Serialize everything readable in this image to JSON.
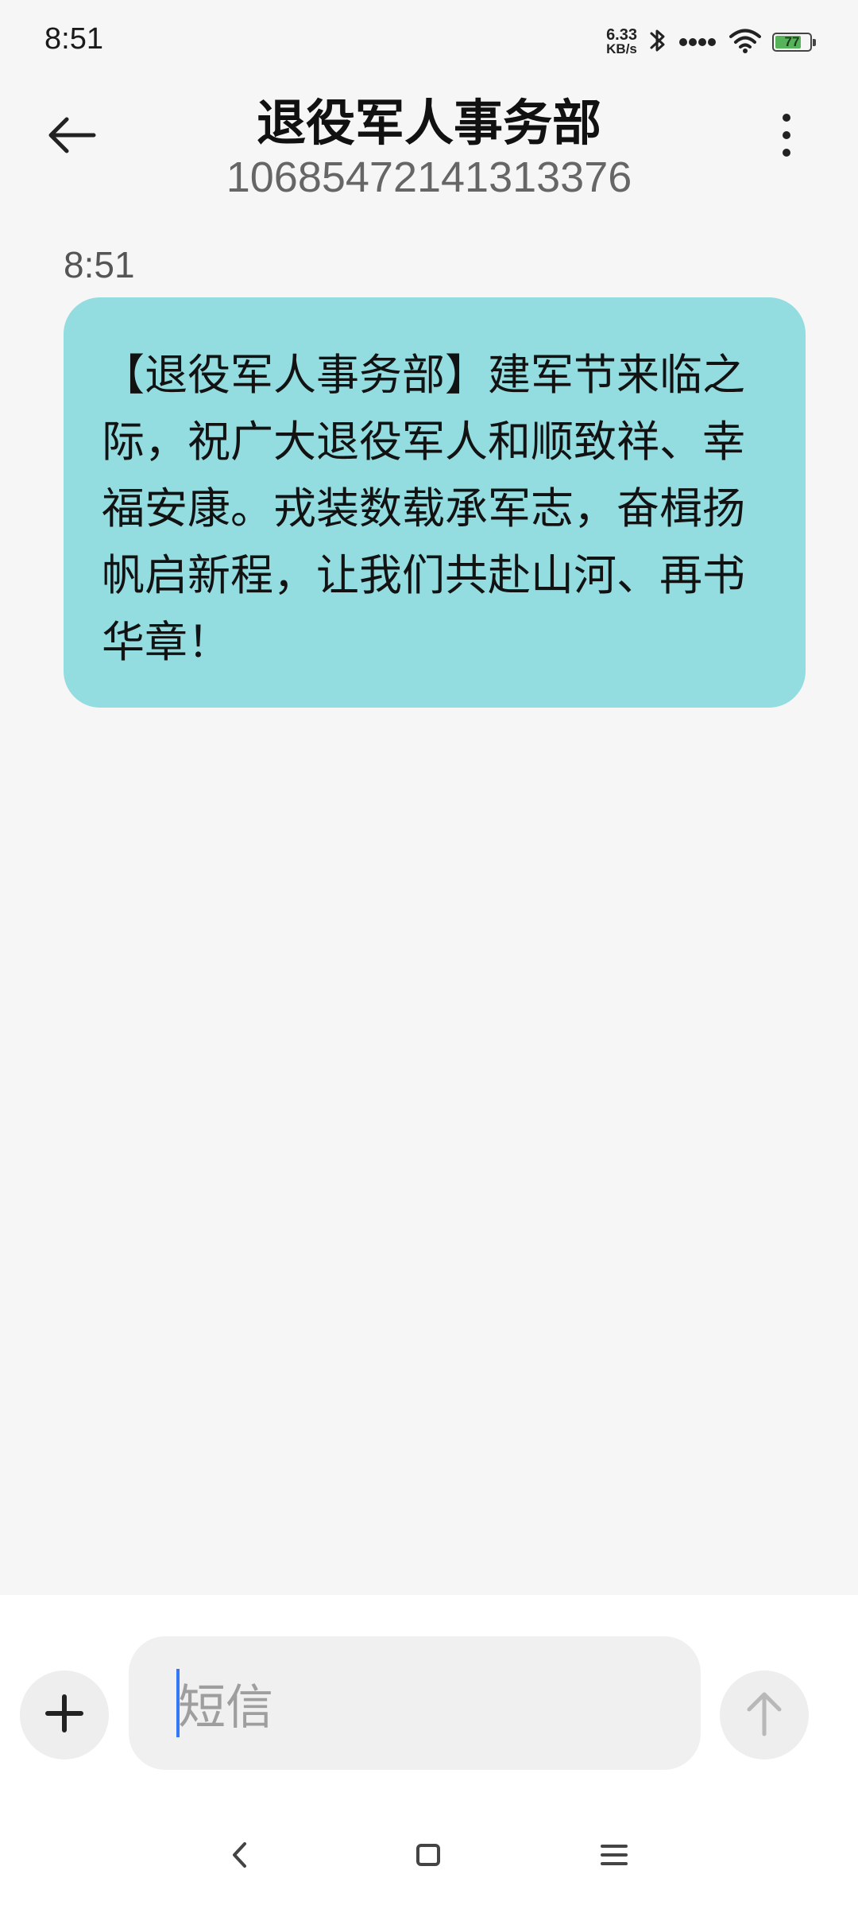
{
  "status_bar": {
    "time": "8:51",
    "net_speed_value": "6.33",
    "net_speed_unit": "KB/s",
    "battery_level": "77",
    "battery_fraction": 0.77
  },
  "header": {
    "title": "退役军人事务部",
    "subtitle": "10685472141313376"
  },
  "conversation": {
    "timestamp": "8:51",
    "message": "【退役军人事务部】建军节来临之际，祝广大退役军人和顺致祥、幸福安康。戎装数载承军志，奋楫扬帆启新程，让我们共赴山河、再书华章！"
  },
  "composer": {
    "placeholder": "短信"
  },
  "colors": {
    "bubble": "#93dce0",
    "background": "#f6f6f6",
    "caret": "#3478f6"
  },
  "icons": {
    "back": "arrow-left-icon",
    "menu": "more-vert-icon",
    "attach": "plus-icon",
    "send": "arrow-up-icon",
    "nav_back": "chevron-left-icon",
    "nav_home": "square-icon",
    "nav_recent": "menu-lines-icon",
    "bluetooth": "bluetooth-icon",
    "signal": "signal-dots-icon",
    "wifi": "wifi-icon",
    "battery": "battery-icon"
  }
}
